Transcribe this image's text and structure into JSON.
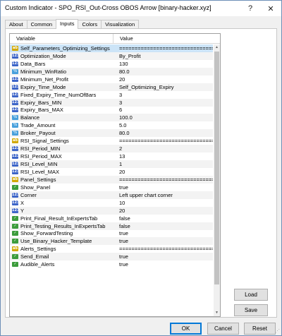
{
  "window": {
    "title": "Custom Indicator - SPO_RSI_Out-Cross OBOS Arrow [binary-hacker.xyz]",
    "help_label": "?",
    "close_label": "✕"
  },
  "tabs": [
    {
      "label": "About"
    },
    {
      "label": "Common"
    },
    {
      "label": "Inputs",
      "active": true
    },
    {
      "label": "Colors"
    },
    {
      "label": "Visualization"
    }
  ],
  "grid": {
    "col_variable": "Variable",
    "col_value": "Value",
    "rows": [
      {
        "icon": "ab",
        "type": "string-icon",
        "name": "Self_Parameters_Optimizing_Settings",
        "value": "=======================================",
        "selected": true
      },
      {
        "icon": "123",
        "type": "enum-icon",
        "name": "Optimization_Mode",
        "value": "By_Profit"
      },
      {
        "icon": "123",
        "type": "int-icon",
        "name": "Data_Bars",
        "value": "130"
      },
      {
        "icon": "½",
        "type": "double-icon",
        "name": "Minimum_WinRatio",
        "value": "80.0"
      },
      {
        "icon": "123",
        "type": "int-icon",
        "name": "Minimum_Net_Profit",
        "value": "20"
      },
      {
        "icon": "123",
        "type": "enum-icon",
        "name": "Expiry_Time_Mode",
        "value": "Self_Optimizing_Expiry"
      },
      {
        "icon": "123",
        "type": "int-icon",
        "name": "Fixed_Expiry_Time_NumOfBars",
        "value": "3"
      },
      {
        "icon": "123",
        "type": "int-icon",
        "name": "Expiry_Bars_MIN",
        "value": "3"
      },
      {
        "icon": "123",
        "type": "int-icon",
        "name": "Expiry_Bars_MAX",
        "value": "6"
      },
      {
        "icon": "½",
        "type": "double-icon",
        "name": "Balance",
        "value": "100.0"
      },
      {
        "icon": "½",
        "type": "double-icon",
        "name": "Trade_Amount",
        "value": "5.0"
      },
      {
        "icon": "½",
        "type": "double-icon",
        "name": "Broker_Payout",
        "value": "80.0"
      },
      {
        "icon": "ab",
        "type": "string-icon",
        "name": "RSI_Signal_Settings",
        "value": "======================================="
      },
      {
        "icon": "123",
        "type": "int-icon",
        "name": "RSI_Period_MIN",
        "value": "2"
      },
      {
        "icon": "123",
        "type": "int-icon",
        "name": "RSI_Period_MAX",
        "value": "13"
      },
      {
        "icon": "123",
        "type": "int-icon",
        "name": "RSI_Level_MIN",
        "value": "1"
      },
      {
        "icon": "123",
        "type": "int-icon",
        "name": "RSI_Level_MAX",
        "value": "20"
      },
      {
        "icon": "ab",
        "type": "string-icon",
        "name": "Panel_Settings",
        "value": "======================================="
      },
      {
        "icon": "✓",
        "type": "bool-icon",
        "name": "Show_Panel",
        "value": "true"
      },
      {
        "icon": "123",
        "type": "enum-icon",
        "name": "Corner",
        "value": "Left upper chart corner"
      },
      {
        "icon": "123",
        "type": "int-icon",
        "name": "X",
        "value": "10"
      },
      {
        "icon": "123",
        "type": "int-icon",
        "name": "Y",
        "value": "20"
      },
      {
        "icon": "✓",
        "type": "bool-icon",
        "name": "Print_Final_Result_InExpertsTab",
        "value": "false"
      },
      {
        "icon": "✓",
        "type": "bool-icon",
        "name": "Print_Testing_Results_InExpertsTab",
        "value": "false"
      },
      {
        "icon": "✓",
        "type": "bool-icon",
        "name": "Show_ForwardTesting",
        "value": "true"
      },
      {
        "icon": "✓",
        "type": "bool-icon",
        "name": "Use_Binary_Hacker_Template",
        "value": "true"
      },
      {
        "icon": "ab",
        "type": "string-icon",
        "name": "Alerts_Settings",
        "value": "======================================="
      },
      {
        "icon": "✓",
        "type": "bool-icon",
        "name": "Send_Email",
        "value": "true"
      },
      {
        "icon": "✓",
        "type": "bool-icon",
        "name": "Audible_Alerts",
        "value": "true"
      }
    ]
  },
  "buttons": {
    "load": "Load",
    "save": "Save",
    "ok": "OK",
    "cancel": "Cancel",
    "reset": "Reset"
  },
  "colors": {
    "selected_row": "#cce4f7",
    "default_button_border": "#0078d7"
  }
}
